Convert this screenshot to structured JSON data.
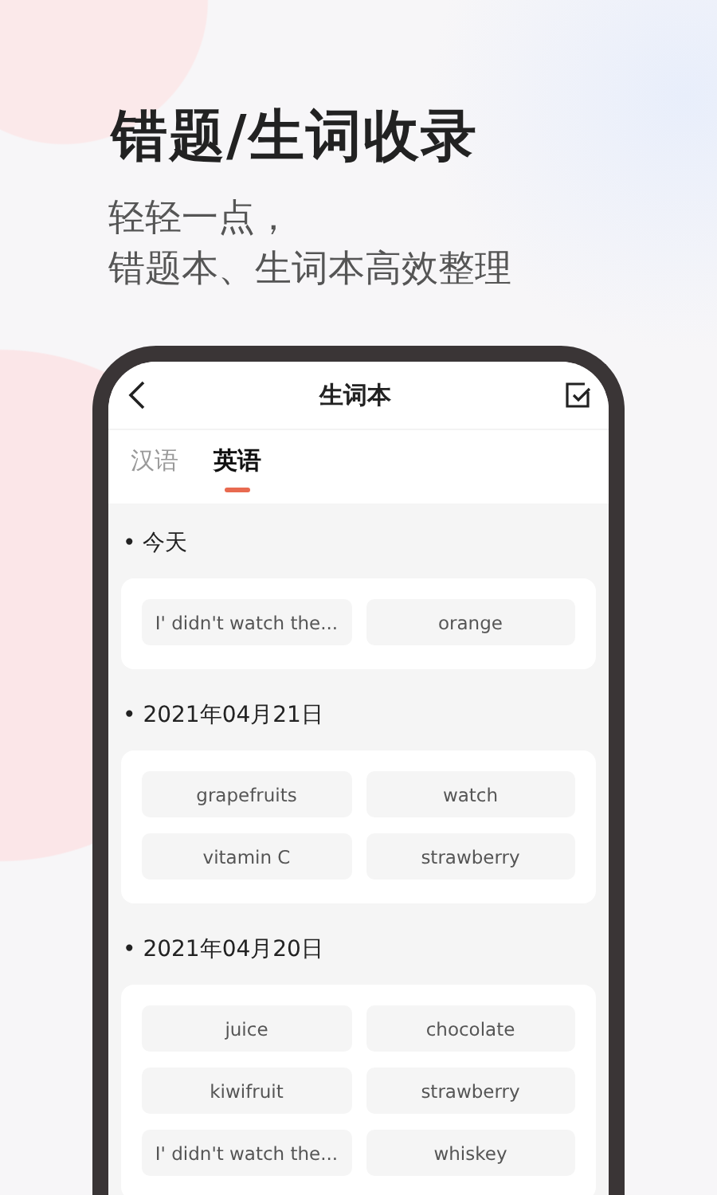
{
  "headline": "错题/生词收录",
  "subtitle_lines": [
    "轻轻一点，",
    "错题本、生词本高效整理"
  ],
  "screen": {
    "title": "生词本",
    "tabs": [
      {
        "label": "汉语",
        "selected": false
      },
      {
        "label": "英语",
        "selected": true
      }
    ],
    "groups": [
      {
        "date": "• 今天",
        "words": [
          "I' didn't watch the...",
          "orange"
        ]
      },
      {
        "date": "• 2021年04月21日",
        "words": [
          "grapefruits",
          "watch",
          "vitamin C",
          "strawberry"
        ]
      },
      {
        "date": "• 2021年04月20日",
        "words": [
          "juice",
          "chocolate",
          "kiwifruit",
          "strawberry",
          "I' didn't watch the...",
          "whiskey"
        ]
      }
    ]
  }
}
